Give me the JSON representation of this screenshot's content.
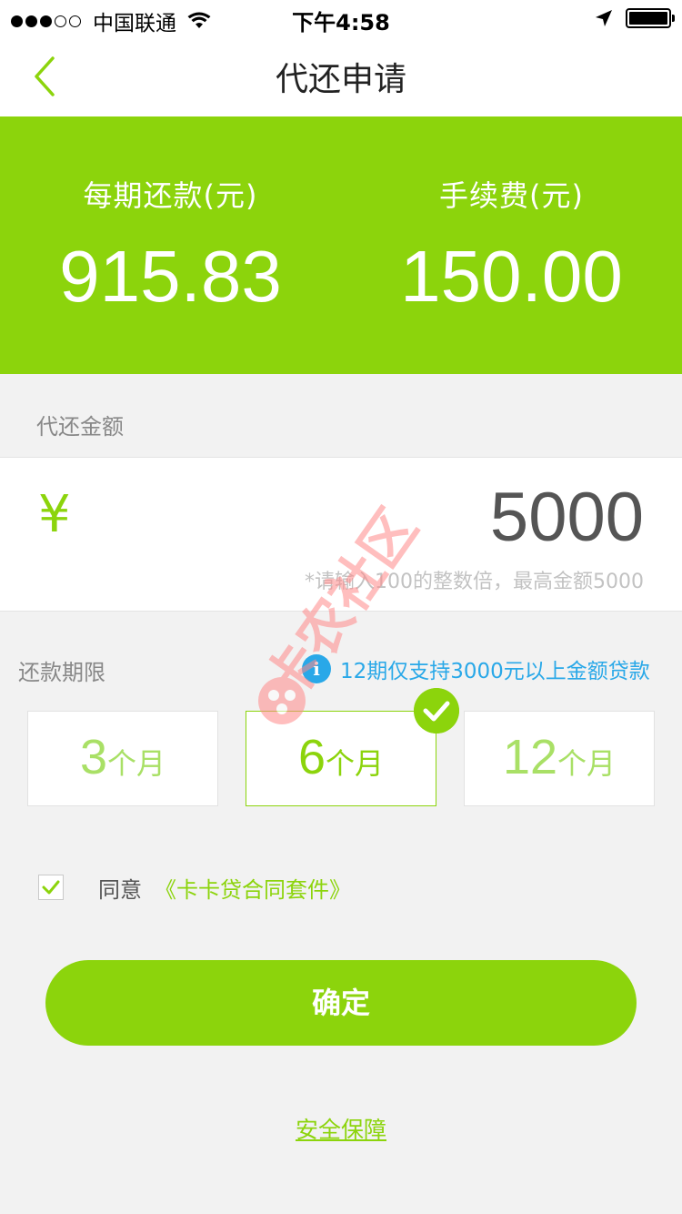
{
  "status_bar": {
    "carrier": "中国联通",
    "time": "下午4:58"
  },
  "nav": {
    "title": "代还申请"
  },
  "summary": {
    "installment_label": "每期还款(元)",
    "installment_value": "915.83",
    "fee_label": "手续费(元)",
    "fee_value": "150.00"
  },
  "amount": {
    "section_label": "代还金额",
    "currency_symbol": "¥",
    "value": "5000",
    "hint": "*请输入100的整数倍，最高金额5000"
  },
  "term": {
    "section_label": "还款期限",
    "note": "12期仅支持3000元以上金额贷款",
    "options": [
      {
        "num": "3",
        "unit": "个月"
      },
      {
        "num": "6",
        "unit": "个月"
      },
      {
        "num": "12",
        "unit": "个月"
      }
    ],
    "selected_index": 1
  },
  "agreement": {
    "prefix": "同意",
    "link": "《卡卡贷合同套件》",
    "checked": true
  },
  "confirm_label": "确定",
  "security_label": "安全保障",
  "watermark_text": "卡农社区",
  "colors": {
    "accent": "#8cd40c",
    "info": "#29a8e8"
  }
}
